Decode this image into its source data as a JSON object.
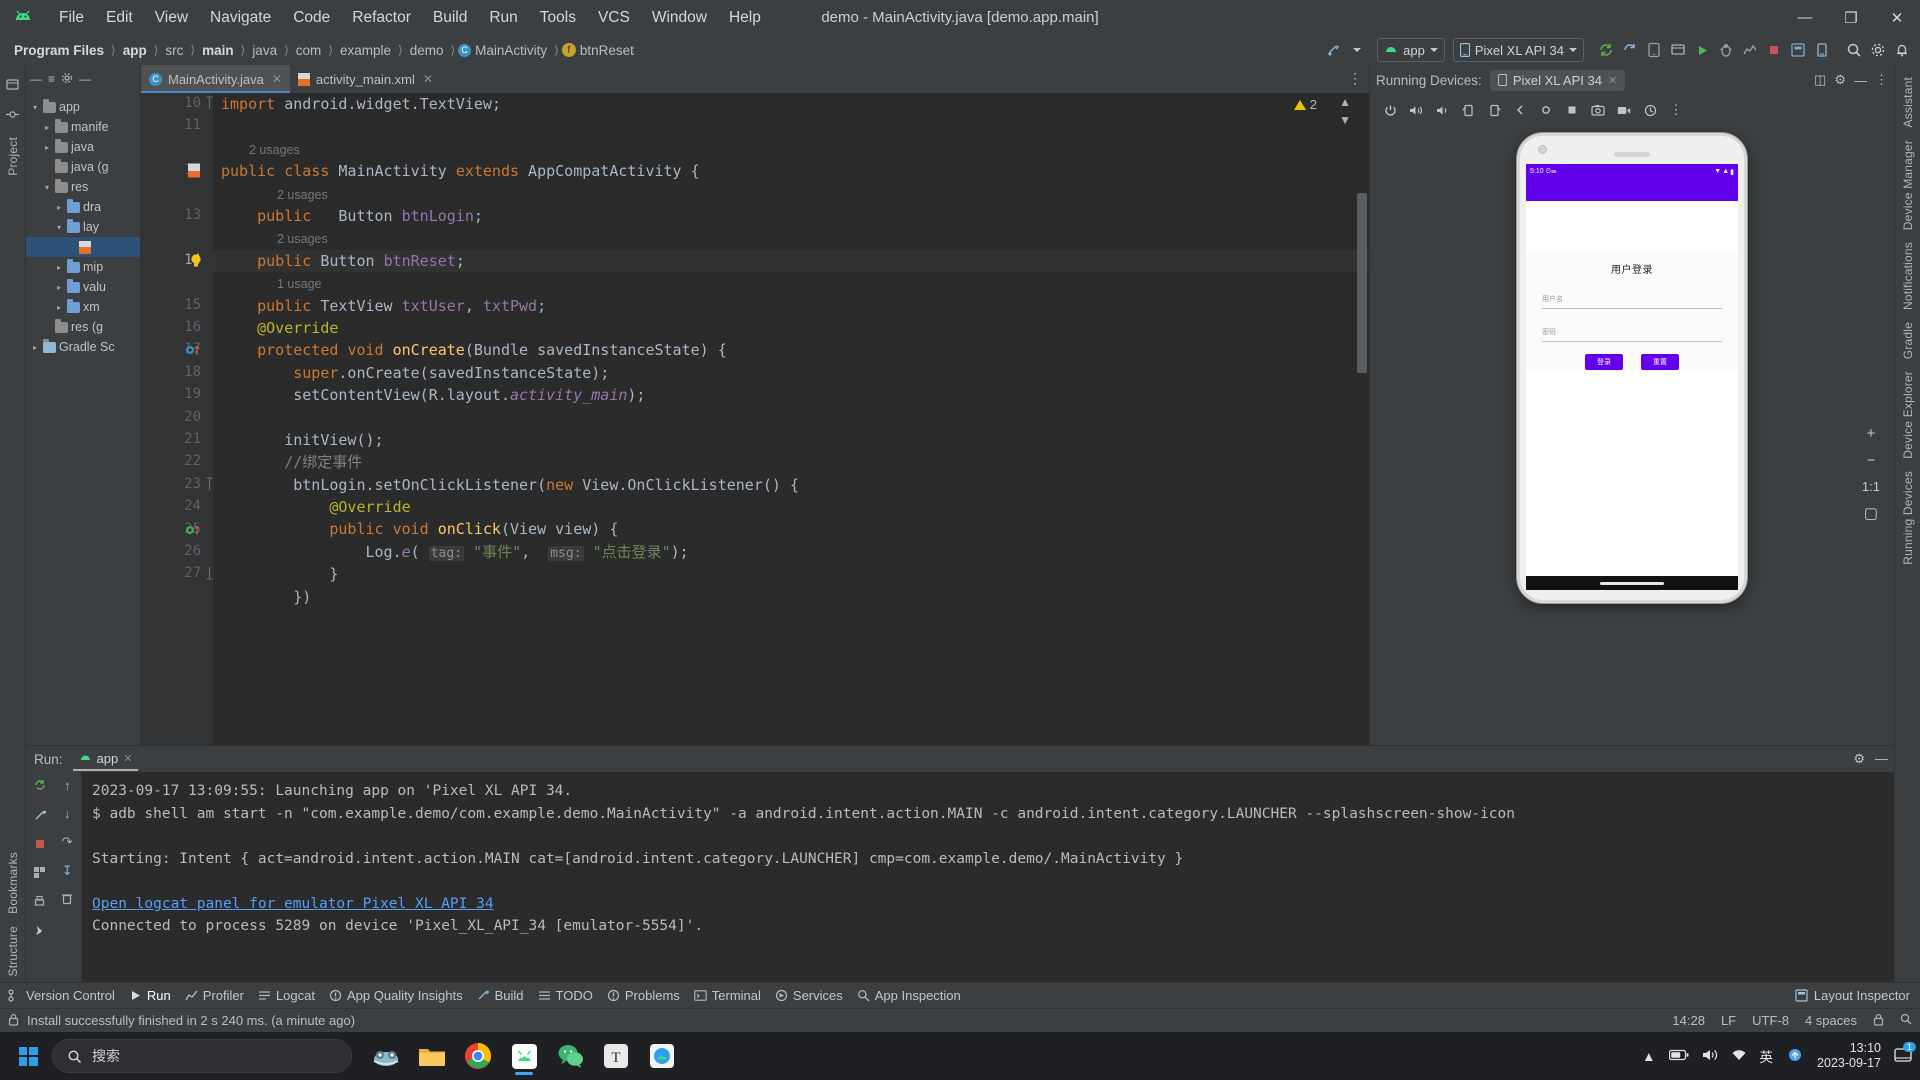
{
  "window": {
    "title": "demo - MainActivity.java [demo.app.main]",
    "minimize": "—",
    "maximize": "❐",
    "close": "✕"
  },
  "menu": {
    "items": [
      "File",
      "Edit",
      "View",
      "Navigate",
      "Code",
      "Refactor",
      "Build",
      "Run",
      "Tools",
      "VCS",
      "Window",
      "Help"
    ]
  },
  "breadcrumb": {
    "items": [
      {
        "label": "Program Files",
        "bold": true
      },
      {
        "label": "app",
        "bold": true
      },
      {
        "label": "src",
        "bold": false
      },
      {
        "label": "main",
        "bold": true
      },
      {
        "label": "java",
        "bold": false
      },
      {
        "label": "com",
        "bold": false
      },
      {
        "label": "example",
        "bold": false
      },
      {
        "label": "demo",
        "bold": false
      },
      {
        "label": "MainActivity",
        "bold": false,
        "icon": "class-icon"
      },
      {
        "label": "btnReset",
        "bold": false,
        "icon": "field-icon"
      }
    ]
  },
  "toolbar": {
    "run_config": "app",
    "device": "Pixel XL API 34",
    "icons": [
      "build-icon",
      "sync-gradle-icon",
      "avd-manager-icon",
      "sdk-manager-icon",
      "run-icon",
      "debug-icon",
      "profile-icon",
      "stop-icon",
      "layout-inspector-icon",
      "device-explorer-icon",
      "search-icon",
      "settings-icon",
      "notifications-icon"
    ]
  },
  "left_rail": {
    "top": [
      "Project"
    ],
    "bottom": [
      "Bookmarks",
      "Structure"
    ],
    "icons": [
      "project-icon",
      "commit-icon",
      "bookmarks-icon",
      "structure-icon"
    ]
  },
  "right_rail": {
    "labels": [
      "Assistant",
      "Device Manager",
      "Notifications",
      "Gradle",
      "Device Explorer",
      "Running Devices"
    ]
  },
  "project_tree": {
    "title": "Project",
    "nodes": [
      {
        "label": "app",
        "depth": 0,
        "arrow": "▾",
        "type": "folder",
        "selected": false
      },
      {
        "label": "manife",
        "depth": 1,
        "arrow": "▸",
        "type": "folder",
        "selected": false
      },
      {
        "label": "java",
        "depth": 1,
        "arrow": "▸",
        "type": "folder",
        "selected": false
      },
      {
        "label": "java (g",
        "depth": 1,
        "arrow": "",
        "type": "folder",
        "selected": false
      },
      {
        "label": "res",
        "depth": 1,
        "arrow": "▾",
        "type": "folder",
        "selected": false
      },
      {
        "label": "dra",
        "depth": 2,
        "arrow": "▸",
        "type": "folder",
        "selected": false
      },
      {
        "label": "lay",
        "depth": 2,
        "arrow": "▾",
        "type": "folder",
        "selected": false
      },
      {
        "label": "",
        "depth": 3,
        "arrow": "",
        "type": "xml",
        "selected": true
      },
      {
        "label": "mip",
        "depth": 2,
        "arrow": "▸",
        "type": "folder",
        "selected": false
      },
      {
        "label": "valu",
        "depth": 2,
        "arrow": "▸",
        "type": "folder",
        "selected": false
      },
      {
        "label": "xm",
        "depth": 2,
        "arrow": "▸",
        "type": "folder",
        "selected": false
      },
      {
        "label": "res (g",
        "depth": 1,
        "arrow": "",
        "type": "folder",
        "selected": false
      },
      {
        "label": "Gradle Sc",
        "depth": 0,
        "arrow": "▸",
        "type": "gradle",
        "selected": false
      }
    ]
  },
  "editor": {
    "tabs": [
      {
        "label": "MainActivity.java",
        "icon": "java-class-icon",
        "active": true,
        "close": "✕"
      },
      {
        "label": "activity_main.xml",
        "icon": "xml-file-icon",
        "active": false,
        "close": "✕"
      }
    ],
    "warning_count": "2",
    "lines": [
      {
        "num": "10",
        "kind": "code",
        "highlight": false,
        "gutter_icon": "fold-minus",
        "tokens": [
          {
            "t": "import",
            "c": "kw"
          },
          {
            "t": " android.widget.TextView",
            "c": "sc"
          },
          {
            "t": ";",
            "c": "sc"
          }
        ]
      },
      {
        "num": "11",
        "kind": "code",
        "highlight": false,
        "tokens": []
      },
      {
        "num": "",
        "kind": "usage",
        "highlight": false,
        "indent": 1,
        "text": "2 usages"
      },
      {
        "num": "12",
        "kind": "code",
        "highlight": false,
        "gutter_icon": "xml-marker",
        "tokens": [
          {
            "t": "public",
            "c": "kw"
          },
          {
            "t": " ",
            "c": "sc"
          },
          {
            "t": "class",
            "c": "kw"
          },
          {
            "t": " MainActivity ",
            "c": "sc"
          },
          {
            "t": "extends",
            "c": "kw"
          },
          {
            "t": " AppCompatActivity {",
            "c": "sc"
          }
        ]
      },
      {
        "num": "",
        "kind": "usage",
        "highlight": false,
        "indent": 2,
        "text": "2 usages"
      },
      {
        "num": "13",
        "kind": "code",
        "highlight": false,
        "tokens": [
          {
            "t": "    ",
            "c": "sc"
          },
          {
            "t": "public",
            "c": "kw"
          },
          {
            "t": "   Button ",
            "c": "sc"
          },
          {
            "t": "btnLogin",
            "c": "fld"
          },
          {
            "t": ";",
            "c": "sc"
          }
        ]
      },
      {
        "num": "",
        "kind": "usage",
        "highlight": false,
        "indent": 2,
        "text": "2 usages"
      },
      {
        "num": "14",
        "kind": "code",
        "highlight": true,
        "gutter_icon": "bulb",
        "tokens": [
          {
            "t": "    ",
            "c": "sc"
          },
          {
            "t": "public",
            "c": "kw"
          },
          {
            "t": " Button ",
            "c": "sc"
          },
          {
            "t": "btnReset",
            "c": "fld"
          },
          {
            "t": ";",
            "c": "sc"
          }
        ]
      },
      {
        "num": "",
        "kind": "usage",
        "highlight": false,
        "indent": 2,
        "text": "1 usage"
      },
      {
        "num": "15",
        "kind": "code",
        "highlight": false,
        "tokens": [
          {
            "t": "    ",
            "c": "sc"
          },
          {
            "t": "public",
            "c": "kw"
          },
          {
            "t": " TextView ",
            "c": "sc"
          },
          {
            "t": "txtUser",
            "c": "fld"
          },
          {
            "t": ", ",
            "c": "sc"
          },
          {
            "t": "txtPwd",
            "c": "fld"
          },
          {
            "t": ";",
            "c": "sc"
          }
        ]
      },
      {
        "num": "16",
        "kind": "code",
        "highlight": false,
        "tokens": [
          {
            "t": "    ",
            "c": "sc"
          },
          {
            "t": "@Override",
            "c": "ann"
          }
        ]
      },
      {
        "num": "17",
        "kind": "code",
        "highlight": false,
        "gutter_icon": "override-blue",
        "tokens": [
          {
            "t": "    ",
            "c": "sc"
          },
          {
            "t": "protected",
            "c": "kw"
          },
          {
            "t": " ",
            "c": "sc"
          },
          {
            "t": "void",
            "c": "kw"
          },
          {
            "t": " ",
            "c": "sc"
          },
          {
            "t": "onCreate",
            "c": "mth"
          },
          {
            "t": "(Bundle savedInstanceState) {",
            "c": "sc"
          }
        ]
      },
      {
        "num": "18",
        "kind": "code",
        "highlight": false,
        "tokens": [
          {
            "t": "        ",
            "c": "sc"
          },
          {
            "t": "super",
            "c": "kw"
          },
          {
            "t": ".onCreate(savedInstanceState);",
            "c": "sc"
          }
        ]
      },
      {
        "num": "19",
        "kind": "code",
        "highlight": false,
        "tokens": [
          {
            "t": "        setContentView(R.layout.",
            "c": "sc"
          },
          {
            "t": "activity_main",
            "c": "ital"
          },
          {
            "t": ");",
            "c": "sc"
          }
        ]
      },
      {
        "num": "20",
        "kind": "code",
        "highlight": false,
        "tokens": []
      },
      {
        "num": "21",
        "kind": "code",
        "highlight": false,
        "tokens": [
          {
            "t": "       initView();",
            "c": "sc"
          }
        ]
      },
      {
        "num": "22",
        "kind": "code",
        "highlight": false,
        "tokens": [
          {
            "t": "       //绑定事件",
            "c": "cmt"
          }
        ]
      },
      {
        "num": "23",
        "kind": "code",
        "highlight": false,
        "gutter_icon": "fold-minus",
        "tokens": [
          {
            "t": "        btnLogin.setOnClickListener(",
            "c": "sc"
          },
          {
            "t": "new",
            "c": "kw"
          },
          {
            "t": " View.OnClickListener() {",
            "c": "sc"
          }
        ]
      },
      {
        "num": "24",
        "kind": "code",
        "highlight": false,
        "tokens": [
          {
            "t": "            ",
            "c": "sc"
          },
          {
            "t": "@Override",
            "c": "ann"
          }
        ]
      },
      {
        "num": "25",
        "kind": "code",
        "highlight": false,
        "gutter_icon": "override-green",
        "tokens": [
          {
            "t": "            ",
            "c": "sc"
          },
          {
            "t": "public",
            "c": "kw"
          },
          {
            "t": " ",
            "c": "sc"
          },
          {
            "t": "void",
            "c": "kw"
          },
          {
            "t": " ",
            "c": "sc"
          },
          {
            "t": "onClick",
            "c": "mth"
          },
          {
            "t": "(View view) {",
            "c": "sc"
          }
        ]
      },
      {
        "num": "26",
        "kind": "code",
        "highlight": false,
        "tokens": [
          {
            "t": "                Log.",
            "c": "sc"
          },
          {
            "t": "e",
            "c": "ital"
          },
          {
            "t": "( ",
            "c": "sc"
          },
          {
            "t": "tag:",
            "c": "hint"
          },
          {
            "t": " ",
            "c": "sc"
          },
          {
            "t": "\"事件\"",
            "c": "str"
          },
          {
            "t": ",  ",
            "c": "sc"
          },
          {
            "t": "msg:",
            "c": "hint"
          },
          {
            "t": " ",
            "c": "sc"
          },
          {
            "t": "\"点击登录\"",
            "c": "str"
          },
          {
            "t": ");",
            "c": "sc"
          }
        ]
      },
      {
        "num": "27",
        "kind": "code",
        "highlight": false,
        "gutter_icon": "fold-end",
        "tokens": [
          {
            "t": "            }",
            "c": "sc"
          }
        ]
      },
      {
        "num": "",
        "kind": "code",
        "highlight": false,
        "tokens": [
          {
            "t": "        })",
            "c": "sc"
          }
        ]
      }
    ]
  },
  "emulator": {
    "panel_title": "Running Devices:",
    "tab_label": "Pixel XL API 34",
    "tab_close": "✕",
    "toolbar_icons": [
      "power-icon",
      "volume-up-icon",
      "volume-down-icon",
      "rotate-left-icon",
      "rotate-right-icon",
      "back-icon",
      "home-icon",
      "overview-icon",
      "screenshot-icon",
      "record-icon",
      "history-icon",
      "more-icon"
    ],
    "zoom_controls": [
      "+",
      "−",
      "1:1",
      "▢"
    ],
    "device_screen": {
      "status_time": "5:10",
      "title": "用户登录",
      "field_user_label": "用户名",
      "field_pwd_label": "密码",
      "button_login": "登录",
      "button_reset": "重置"
    }
  },
  "run_window": {
    "label": "Run:",
    "tab": "app",
    "tab_close": "✕",
    "console_lines": [
      {
        "text": "2023-09-17 13:09:55: Launching app on 'Pixel XL API 34.",
        "type": "plain"
      },
      {
        "text": "$ adb shell am start -n \"com.example.demo/com.example.demo.MainActivity\" -a android.intent.action.MAIN -c android.intent.category.LAUNCHER --splashscreen-show-icon",
        "type": "plain"
      },
      {
        "text": "",
        "type": "plain"
      },
      {
        "text": "Starting: Intent { act=android.intent.action.MAIN cat=[android.intent.category.LAUNCHER] cmp=com.example.demo/.MainActivity }",
        "type": "plain"
      },
      {
        "text": "",
        "type": "plain"
      },
      {
        "text": "Open logcat panel for emulator Pixel XL API 34",
        "type": "link"
      },
      {
        "text": "Connected to process 5289 on device 'Pixel_XL_API_34 [emulator-5554]'.",
        "type": "plain"
      }
    ],
    "side_icons": [
      "rerun-icon",
      "up-icon",
      "wrench-icon",
      "down-icon",
      "stop-icon",
      "wrap-icon",
      "scroll-end-icon",
      "print-icon",
      "pin-icon",
      "trash-icon"
    ]
  },
  "bottom_tabs": [
    {
      "label": "Version Control",
      "icon": "vcs-icon",
      "active": false
    },
    {
      "label": "Run",
      "icon": "run-icon",
      "active": true
    },
    {
      "label": "Profiler",
      "icon": "profiler-icon",
      "active": false
    },
    {
      "label": "Logcat",
      "icon": "logcat-icon",
      "active": false
    },
    {
      "label": "App Quality Insights",
      "icon": "insights-icon",
      "active": false
    },
    {
      "label": "Build",
      "icon": "build-icon",
      "active": false
    },
    {
      "label": "TODO",
      "icon": "todo-icon",
      "active": false
    },
    {
      "label": "Problems",
      "icon": "problems-icon",
      "active": false
    },
    {
      "label": "Terminal",
      "icon": "terminal-icon",
      "active": false
    },
    {
      "label": "Services",
      "icon": "services-icon",
      "active": false
    },
    {
      "label": "App Inspection",
      "icon": "inspection-icon",
      "active": false
    }
  ],
  "bottom_right": {
    "label": "Layout Inspector",
    "icon": "layout-inspector-icon"
  },
  "status_bar": {
    "message": "Install successfully finished in 2 s 240 ms. (a minute ago)",
    "time": "14:28",
    "line_sep": "LF",
    "encoding": "UTF-8",
    "indent": "4 spaces",
    "lock_icon": "lock-icon"
  },
  "taskbar": {
    "search_placeholder": "搜索",
    "apps": [
      {
        "name": "file-explorer-icon"
      },
      {
        "name": "chrome-icon"
      },
      {
        "name": "android-studio-icon",
        "running": true
      },
      {
        "name": "wechat-icon"
      },
      {
        "name": "typora-icon"
      },
      {
        "name": "app-icon"
      }
    ],
    "tray_icons": [
      "chevron-up-icon",
      "battery-icon",
      "volume-icon",
      "network-icon",
      "ime-icon",
      "cloud-icon"
    ],
    "ime_label": "英",
    "clock_time": "13:10",
    "clock_date": "2023-09-17",
    "notification_count": "1"
  },
  "colors": {
    "accent": "#4a88c7",
    "editor_bg": "#2b2b2b",
    "panel_bg": "#3c3f41",
    "android_purple": "#6200ee",
    "string_green": "#6a8759",
    "keyword_orange": "#cc7832",
    "field_purple": "#9876aa",
    "method_yellow": "#ffc66d"
  }
}
